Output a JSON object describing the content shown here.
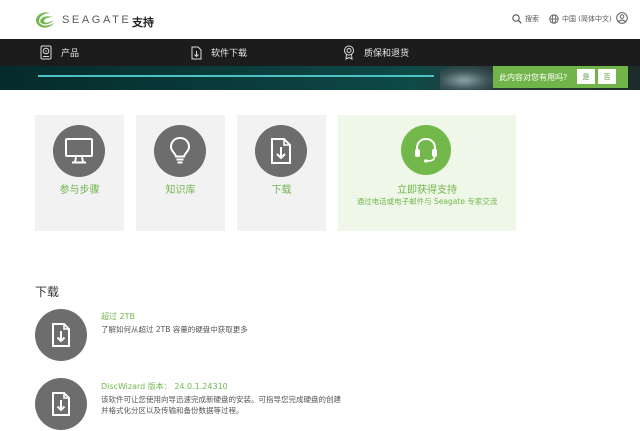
{
  "header": {
    "logo_text": "SEAGATE",
    "title": "支持",
    "search_label": "搜索",
    "language_label": "中国 (简体中文)",
    "brand_color": "#74b64e"
  },
  "nav": {
    "items": [
      {
        "label": "产品",
        "icon": "hard-drive-icon"
      },
      {
        "label": "软件下载",
        "icon": "download-file-icon"
      },
      {
        "label": "质保和退货",
        "icon": "warranty-badge-icon"
      }
    ]
  },
  "banner": {
    "feedback_question": "此内容对您有用吗?",
    "yes_label": "是",
    "no_label": "否"
  },
  "cards": [
    {
      "label": "参与步骤",
      "icon": "monitor-icon"
    },
    {
      "label": "知识库",
      "icon": "lightbulb-icon"
    },
    {
      "label": "下载",
      "icon": "download-file-icon"
    },
    {
      "label": "立即获得支持",
      "sub": "通过电话或电子邮件与 Seagate 专家交流",
      "icon": "headset-icon"
    }
  ],
  "downloads": {
    "title": "下载",
    "items": [
      {
        "title": "超过 2TB",
        "desc": "了解如何从超过 2TB 容量的硬盘中获取更多",
        "icon": "download-file-icon"
      },
      {
        "title": "DiscWizard 版本： 24.0.1.24310",
        "desc": "该软件可让您使用向导迅速完成新硬盘的安装。可指导您完成硬盘的创建并格式化分区以及传输和备份数据等过程。",
        "icon": "download-file-icon"
      }
    ]
  }
}
